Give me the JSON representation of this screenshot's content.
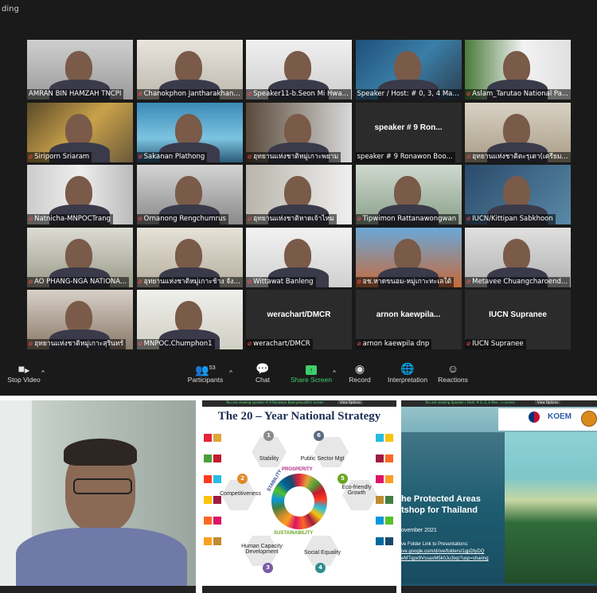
{
  "zoom_top_label": "ding",
  "participants": [
    {
      "name": "AMRAN BIN HAMZAH TNCPI",
      "muted": false
    },
    {
      "name": "Chanokphon Jantharakhant...",
      "muted": true
    },
    {
      "name": "Speaker11-b.Seon Mi Hwa...",
      "muted": true
    },
    {
      "name": "Speaker / Host: # 0, 3, 4 Mae...",
      "muted": false
    },
    {
      "name": "Aslam_Tarutao National Pa...",
      "muted": true
    },
    {
      "name": "Siriporn Sriaram",
      "muted": true
    },
    {
      "name": "Sakanan Plathong",
      "muted": true
    },
    {
      "name": "อุทยานแห่งชาติหมู่เกาะพยาม",
      "muted": true
    },
    {
      "name": "speaker # 9 Ronawon Boo...",
      "muted": false,
      "center": "speaker # 9 Ron..."
    },
    {
      "name": "อุทยานแห่งชาติตะรุเตา(เตรียม...",
      "muted": true
    },
    {
      "name": "Natnicha-MNPOCTrang",
      "muted": true
    },
    {
      "name": "Ornanong Rengchumrus",
      "muted": true
    },
    {
      "name": "อุทยานแห่งชาติหาดเจ้าไหม",
      "muted": true
    },
    {
      "name": "Tipwimon Rattanawongwan",
      "muted": true
    },
    {
      "name": "IUCN/Kittipan Sabkhoon",
      "muted": true
    },
    {
      "name": "AO PHANG-NGA NATIONA...",
      "muted": true
    },
    {
      "name": "อุทยานแห่งชาติหมู่เกาะช้าง จังห...",
      "muted": true
    },
    {
      "name": "Wittawat Banleng",
      "muted": true
    },
    {
      "name": "อช.หาดขนอม-หมู่เกาะทะเลใต้",
      "muted": true
    },
    {
      "name": "Metavee Chuangcharoend...",
      "muted": true
    },
    {
      "name": "อุทยานแห่งชาติหมู่เกาะสุรินทร์",
      "muted": true
    },
    {
      "name": "MNPOC.Chumphon1",
      "muted": true
    },
    {
      "name": "werachart/DMCR",
      "muted": true,
      "center": "werachart/DMCR"
    },
    {
      "name": "arnon kaewpila dnp",
      "muted": true,
      "center": "arnon  kaewpila..."
    },
    {
      "name": "IUCN Supranee",
      "muted": true,
      "center": "IUCN Supranee"
    }
  ],
  "toolbar": {
    "stop_video": "Stop Video",
    "participants": "Participants",
    "participants_count": "53",
    "chat": "Chat",
    "share_screen": "Share Screen",
    "record": "Record",
    "interpretation": "Interpretation",
    "reactions": "Reactions"
  },
  "slide_strategy": {
    "banner": "You are viewing speaker # 9 Ronawon Boonyanusith's screen",
    "view_options": "View Options",
    "title": "The 20 – Year National Strategy",
    "items": [
      {
        "num": "1",
        "label": "Stability"
      },
      {
        "num": "6",
        "label": "Public Sector Mgt"
      },
      {
        "num": "2",
        "label": "Competitiveness"
      },
      {
        "num": "5",
        "label": "Eco-friendly Growth"
      },
      {
        "num": "3",
        "label": "Human Capacity Development"
      },
      {
        "num": "4",
        "label": "Social Equality"
      }
    ],
    "center_words": [
      "STABILITY",
      "PROSPERITY",
      "SUSTAINABILITY"
    ]
  },
  "slide_workshop": {
    "banner": "You are viewing Speaker / Host: # 0, 3, 4 Mae...'s screen",
    "view_options": "View Options",
    "logo_text": "KOEM",
    "title_line1": "he Protected Areas",
    "title_line2": "tshop for Thailand",
    "date": "ovember 2021",
    "link_line1": "ve Folder Link to Presentations:",
    "link_line2": "ive.google.com/drive/folders/1gpDtyDQ",
    "link_line3": "eMTqpx9VssaxM5k0Ju3ixp?usp=sharing"
  },
  "colors": {
    "active_border": "#c7e84a",
    "share_green": "#3ecf6a",
    "muted_red": "#ff4d4d"
  }
}
